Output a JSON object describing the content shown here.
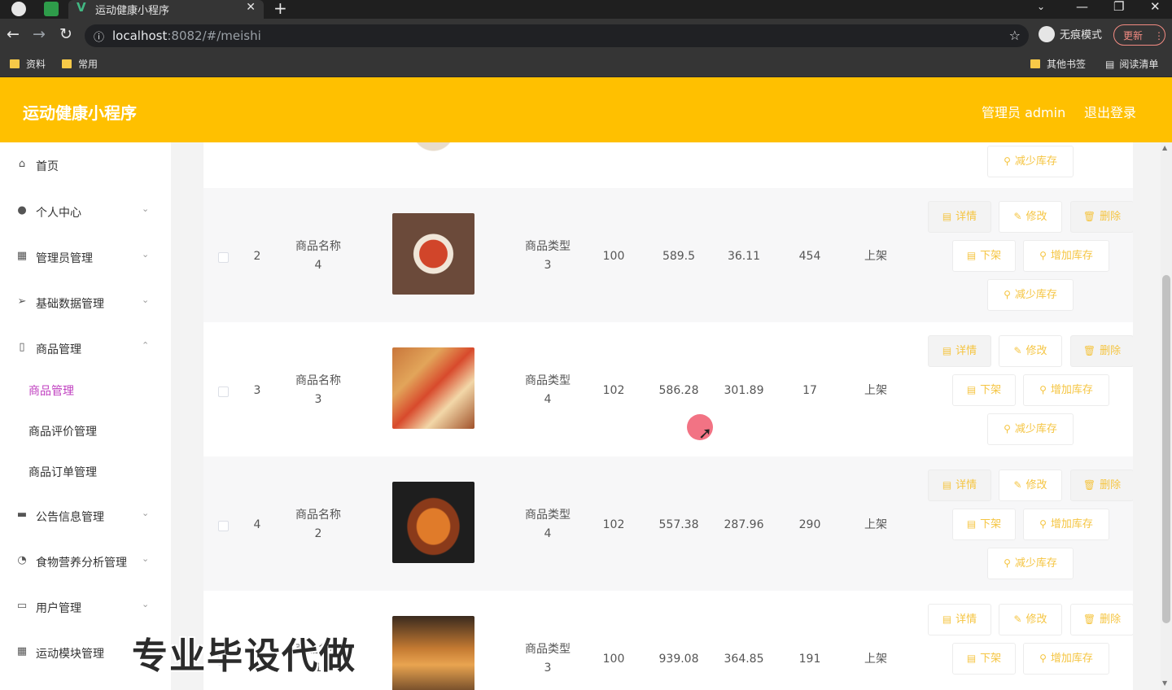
{
  "browser": {
    "tab_title": "运动健康小程序",
    "url_host": "localhost",
    "url_rest": ":8082/#/meishi",
    "incognito_label": "无痕模式",
    "update_label": "更新",
    "bookmarks": [
      "资料",
      "常用"
    ],
    "bookmarks_right": [
      "其他书签",
      "阅读清单"
    ]
  },
  "header": {
    "title": "运动健康小程序",
    "admin": "管理员 admin",
    "logout": "退出登录"
  },
  "sidebar": {
    "items": [
      {
        "label": "首页",
        "icon": "home-icon"
      },
      {
        "label": "个人中心",
        "icon": "user-icon"
      },
      {
        "label": "管理员管理",
        "icon": "grid-icon"
      },
      {
        "label": "基础数据管理",
        "icon": "send-icon"
      },
      {
        "label": "商品管理",
        "icon": "phone-icon"
      },
      {
        "label": "公告信息管理",
        "icon": "briefcase-icon"
      },
      {
        "label": "食物营养分析管理",
        "icon": "gauge-icon"
      },
      {
        "label": "用户管理",
        "icon": "chat-icon"
      },
      {
        "label": "运动模块管理",
        "icon": "grid-icon"
      }
    ],
    "sub_items": [
      "商品管理",
      "商品评价管理",
      "商品订单管理"
    ]
  },
  "table": {
    "rows": [
      {
        "index": "2",
        "name": "商品名称\n4",
        "type": "商品类型\n3",
        "c1": "100",
        "c2": "589.5",
        "c3": "36.11",
        "c4": "454",
        "status": "上架"
      },
      {
        "index": "3",
        "name": "商品名称\n3",
        "type": "商品类型\n4",
        "c1": "102",
        "c2": "586.28",
        "c3": "301.89",
        "c4": "17",
        "status": "上架"
      },
      {
        "index": "4",
        "name": "商品名称\n2",
        "type": "商品类型\n4",
        "c1": "102",
        "c2": "557.38",
        "c3": "287.96",
        "c4": "290",
        "status": "上架"
      },
      {
        "index": "",
        "name": "商品名称\n1",
        "type": "商品类型\n3",
        "c1": "100",
        "c2": "939.08",
        "c3": "364.85",
        "c4": "191",
        "status": "上架"
      }
    ],
    "buttons": {
      "detail": "详情",
      "edit": "修改",
      "delete": "删除",
      "offshelf": "下架",
      "add_stock": "增加库存",
      "reduce_stock": "减少库存"
    }
  },
  "watermark": "专业毕设代做"
}
